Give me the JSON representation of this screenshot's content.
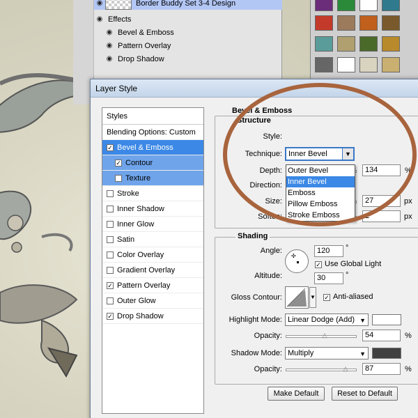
{
  "layers": {
    "layer_name": "Border Buddy Set 3-4 Design",
    "effects_label": "Effects",
    "effects": [
      "Bevel & Emboss",
      "Pattern Overlay",
      "Drop Shadow"
    ]
  },
  "dialog": {
    "title": "Layer Style",
    "styles_header": "Styles",
    "blending": "Blending Options: Custom",
    "items": [
      {
        "label": "Bevel & Emboss",
        "checked": true,
        "state": "selected"
      },
      {
        "label": "Contour",
        "checked": true,
        "state": "sub"
      },
      {
        "label": "Texture",
        "checked": false,
        "state": "sub"
      },
      {
        "label": "Stroke",
        "checked": false
      },
      {
        "label": "Inner Shadow",
        "checked": false
      },
      {
        "label": "Inner Glow",
        "checked": false
      },
      {
        "label": "Satin",
        "checked": false
      },
      {
        "label": "Color Overlay",
        "checked": false
      },
      {
        "label": "Gradient Overlay",
        "checked": false
      },
      {
        "label": "Pattern Overlay",
        "checked": true
      },
      {
        "label": "Outer Glow",
        "checked": false
      },
      {
        "label": "Drop Shadow",
        "checked": true
      }
    ]
  },
  "bevel": {
    "title": "Bevel & Emboss",
    "structure": "Structure",
    "style_label": "Style:",
    "style_value": "Inner Bevel",
    "technique_label": "Technique:",
    "depth_label": "Depth:",
    "depth_value": "134",
    "depth_unit": "%",
    "direction_label": "Direction:",
    "size_label": "Size:",
    "size_value": "27",
    "size_unit": "px",
    "soften_label": "Soften:",
    "soften_value": "2",
    "soften_unit": "px",
    "style_options": [
      "Outer Bevel",
      "Inner Bevel",
      "Emboss",
      "Pillow Emboss",
      "Stroke Emboss"
    ],
    "selected_option": 1
  },
  "shading": {
    "title": "Shading",
    "angle_label": "Angle:",
    "angle_value": "120",
    "degree": "°",
    "global_light": "Use Global Light",
    "altitude_label": "Altitude:",
    "altitude_value": "30",
    "gloss_label": "Gloss Contour:",
    "anti_aliased": "Anti-aliased",
    "highlight_label": "Highlight Mode:",
    "highlight_value": "Linear Dodge (Add)",
    "highlight_color": "#ffffff",
    "opacity_label": "Opacity:",
    "highlight_opacity": "54",
    "highlight_opacity_level": 0.54,
    "shadow_label": "Shadow Mode:",
    "shadow_value": "Multiply",
    "shadow_color": "#404040",
    "shadow_opacity": "87",
    "shadow_opacity_level": 0.87,
    "percent": "%"
  },
  "buttons": {
    "make_default": "Make Default",
    "reset_default": "Reset to Default"
  }
}
